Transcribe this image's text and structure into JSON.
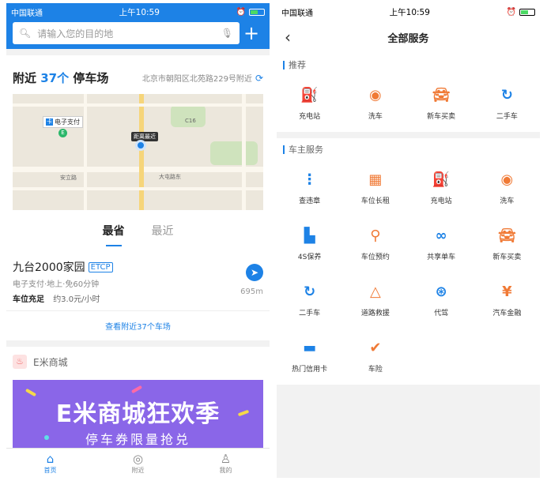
{
  "status_bar": {
    "carrier": "中国联通",
    "time": "上午10:59"
  },
  "left": {
    "search": {
      "placeholder": "请输入您的目的地"
    },
    "nearby": {
      "prefix": "附近",
      "count": "37个",
      "suffix": "停车场",
      "address": "北京市朝阳区北苑路229号附近"
    },
    "map": {
      "labels": [
        "电子支付",
        "距离最近",
        "大屯路东",
        "C16",
        "安立路"
      ],
      "marker_letter": "E"
    },
    "tabs": [
      "最省",
      "最近"
    ],
    "lot": {
      "name": "九台2000家园",
      "tag": "ETCP",
      "info": "电子支付·地上·免60分钟",
      "availability": "车位充足",
      "price": "约3.0元/小时",
      "distance": "695m"
    },
    "view_more": "查看附近37个车场",
    "mall": {
      "title": "E米商城",
      "banner_title": "E米商城狂欢季",
      "banner_sub": "停车券限量抢兑"
    },
    "tabbar": [
      "首页",
      "附近",
      "我的"
    ]
  },
  "right": {
    "title": "全部服务",
    "recommend": {
      "title": "推荐",
      "items": [
        {
          "label": "充电站",
          "icon": "charging-station-icon"
        },
        {
          "label": "洗车",
          "icon": "car-wash-icon"
        },
        {
          "label": "新车买卖",
          "icon": "new-car-icon"
        },
        {
          "label": "二手车",
          "icon": "used-car-icon"
        }
      ]
    },
    "owner": {
      "title": "车主服务",
      "items": [
        {
          "label": "查违章",
          "icon": "traffic-light-icon"
        },
        {
          "label": "车位长租",
          "icon": "calendar-icon"
        },
        {
          "label": "充电站",
          "icon": "charging-station-icon"
        },
        {
          "label": "洗车",
          "icon": "car-wash-icon"
        },
        {
          "label": "4S保养",
          "icon": "oil-can-icon"
        },
        {
          "label": "车位预约",
          "icon": "location-pin-icon"
        },
        {
          "label": "共享单车",
          "icon": "bicycle-icon"
        },
        {
          "label": "新车买卖",
          "icon": "new-car-icon"
        },
        {
          "label": "二手车",
          "icon": "used-car-icon"
        },
        {
          "label": "道路救援",
          "icon": "warning-triangle-icon"
        },
        {
          "label": "代驾",
          "icon": "steering-wheel-icon"
        },
        {
          "label": "汽车金融",
          "icon": "finance-icon"
        },
        {
          "label": "热门信用卡",
          "icon": "credit-card-icon"
        },
        {
          "label": "车险",
          "icon": "shield-icon"
        }
      ]
    }
  }
}
